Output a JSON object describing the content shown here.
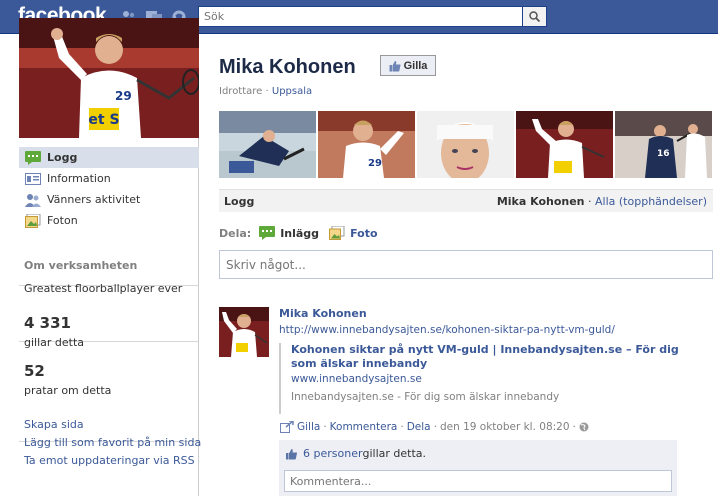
{
  "topbar": {
    "logo": "facebook",
    "search_placeholder": "Sök",
    "icons": [
      "friend-requests-icon",
      "messages-icon",
      "notifications-icon",
      "search-icon"
    ],
    "color": "#3b5998"
  },
  "left": {
    "nav": [
      {
        "label": "Logg",
        "icon": "wall-icon",
        "active": true
      },
      {
        "label": "Information",
        "icon": "info-icon"
      },
      {
        "label": "Vänners aktivitet",
        "icon": "friends-icon"
      },
      {
        "label": "Foton",
        "icon": "photos-icon"
      }
    ],
    "about_heading": "Om verksamheten",
    "about_text": "Greatest floorballplayer ever",
    "likes_count": "4 331",
    "likes_label": "gillar detta",
    "talking_count": "52",
    "talking_label": "pratar om detta",
    "links": [
      "Skapa sida",
      "Lägg till som favorit på min sida",
      "Ta emot uppdateringar via RSS"
    ]
  },
  "page": {
    "name": "Mika Kohonen",
    "like_button": "Gilla",
    "category": "Idrottare",
    "category_sep": " · ",
    "location": "Uppsala"
  },
  "tabs": {
    "wall": "Logg",
    "filter_name": "Mika Kohonen",
    "filter_sep": " · ",
    "filter_all": "Alla (topphändelser)"
  },
  "share": {
    "label": "Dela:",
    "post": "Inlägg",
    "photo": "Foto",
    "composer_placeholder": "Skriv något..."
  },
  "story": {
    "author": "Mika Kohonen",
    "url": "http://www.innebandysajten.se/kohonen-siktar-pa-nytt-vm-guld/",
    "attachment_title": "Kohonen siktar på nytt VM-guld | Innebandysajten.se – För dig som älskar innebandy",
    "attachment_domain": "www.innebandysajten.se",
    "attachment_caption": "Innebandysajten.se - För dig som älskar innebandy",
    "action_like": "Gilla",
    "action_comment": "Kommentera",
    "action_share": "Dela",
    "timestamp": "den 19 oktober kl. 08:20",
    "sep": "·",
    "likes_people": "6 personer",
    "likes_suffix": " gillar detta.",
    "comment_placeholder": "Kommentera..."
  }
}
